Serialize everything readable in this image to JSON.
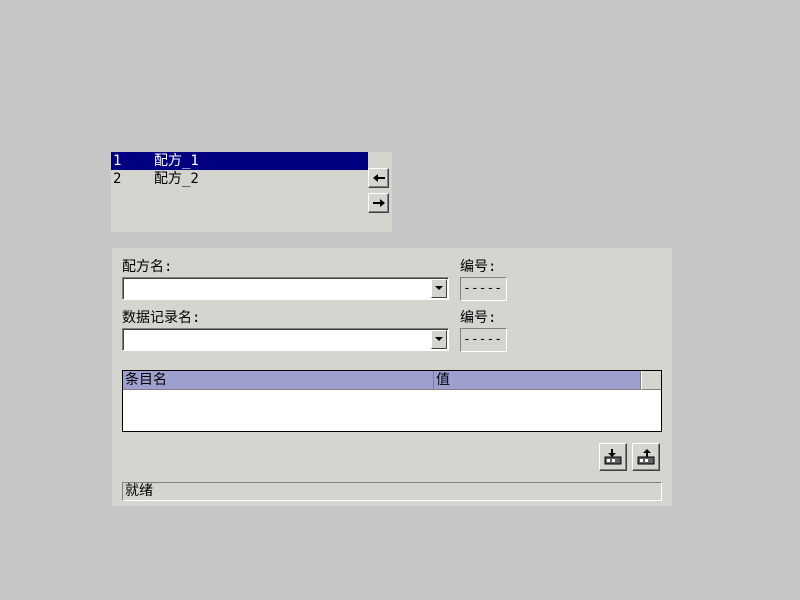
{
  "recipe_list": {
    "items": [
      {
        "number": "1",
        "name": "配方_1",
        "selected": true
      },
      {
        "number": "2",
        "name": "配方_2",
        "selected": false
      }
    ],
    "left_arrow_icon": "arrow-left-icon",
    "right_arrow_icon": "arrow-right-icon"
  },
  "form": {
    "recipe_name_label": "配方名:",
    "recipe_name_value": "",
    "recipe_number_label": "编号:",
    "recipe_number_value": "-----",
    "record_name_label": "数据记录名:",
    "record_name_value": "",
    "record_number_label": "编号:",
    "record_number_value": "-----"
  },
  "table": {
    "columns": [
      "条目名",
      "值"
    ],
    "rows": []
  },
  "toolbar": {
    "import_icon": "import-icon",
    "export_icon": "export-icon"
  },
  "status": {
    "text": "就绪"
  },
  "colors": {
    "background": "#c6c6c6",
    "panel": "#d5d5cf",
    "selection": "#010080",
    "table_header": "#9d9fcf"
  }
}
